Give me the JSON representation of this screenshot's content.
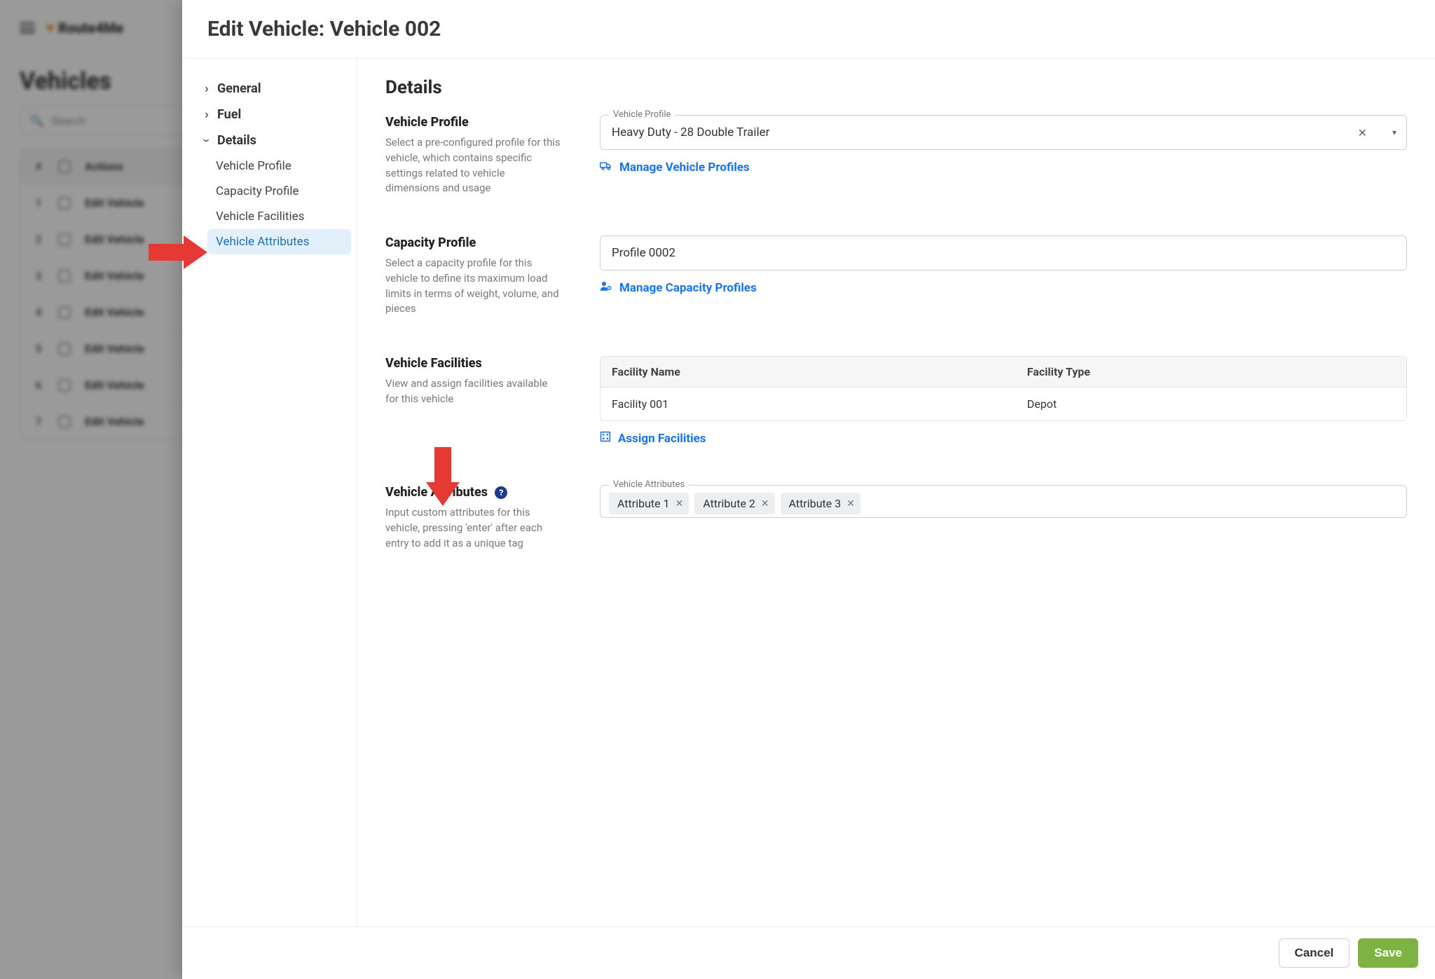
{
  "bg": {
    "logo_text": "Route4Me",
    "page_title": "Vehicles",
    "search_placeholder": "Search",
    "columns": {
      "actions": "Actions"
    },
    "rows": [
      {
        "n": "1",
        "action": "Edit Vehicle"
      },
      {
        "n": "2",
        "action": "Edit Vehicle"
      },
      {
        "n": "3",
        "action": "Edit Vehicle"
      },
      {
        "n": "4",
        "action": "Edit Vehicle"
      },
      {
        "n": "5",
        "action": "Edit Vehicle"
      },
      {
        "n": "6",
        "action": "Edit Vehicle"
      },
      {
        "n": "7",
        "action": "Edit Vehicle"
      }
    ]
  },
  "modal": {
    "title": "Edit Vehicle: Vehicle 002",
    "nav": {
      "general": "General",
      "fuel": "Fuel",
      "details": "Details",
      "sub": {
        "vehicle_profile": "Vehicle Profile",
        "capacity_profile": "Capacity Profile",
        "vehicle_facilities": "Vehicle Facilities",
        "vehicle_attributes": "Vehicle Attributes"
      }
    },
    "section_title": "Details",
    "vehicle_profile": {
      "heading": "Vehicle Profile",
      "desc": "Select a pre-configured profile for this vehicle, which contains specific settings related to vehicle dimensions and usage",
      "field_label": "Vehicle Profile",
      "value": "Heavy Duty - 28 Double Trailer",
      "manage_link": "Manage Vehicle Profiles"
    },
    "capacity_profile": {
      "heading": "Capacity Profile",
      "desc": "Select a capacity profile for this vehicle to define its maximum load limits in terms of weight, volume, and pieces",
      "value": "Profile 0002",
      "manage_link": "Manage Capacity Profiles"
    },
    "facilities": {
      "heading": "Vehicle Facilities",
      "desc": "View and assign facilities available for this vehicle",
      "col_name": "Facility Name",
      "col_type": "Facility Type",
      "row_name": "Facility 001",
      "row_type": "Depot",
      "assign_link": "Assign Facilities"
    },
    "attributes": {
      "heading": "Vehicle Attributes",
      "desc": "Input custom attributes for this vehicle, pressing 'enter' after each entry to add it as a unique tag",
      "field_label": "Vehicle Attributes",
      "chips": [
        "Attribute 1",
        "Attribute 2",
        "Attribute 3"
      ]
    },
    "footer": {
      "cancel": "Cancel",
      "save": "Save"
    }
  }
}
